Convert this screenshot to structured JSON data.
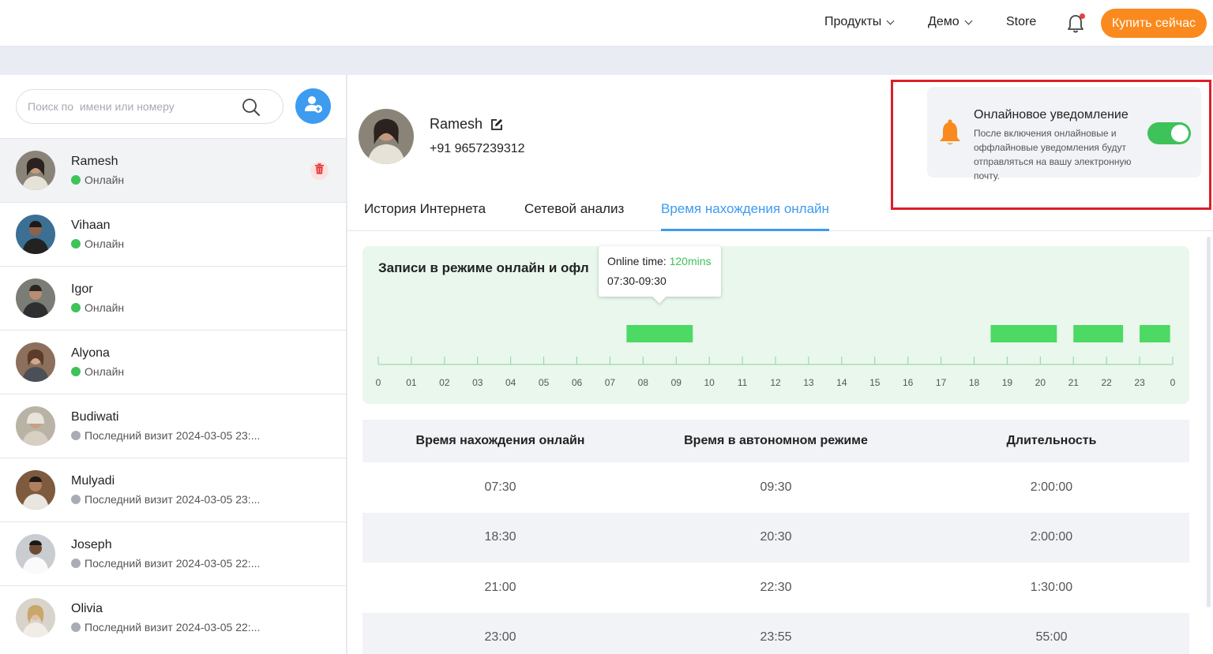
{
  "nav": {
    "products": "Продукты",
    "demo": "Демо",
    "store": "Store",
    "buy_now": "Купить сейчас"
  },
  "sidebar": {
    "search_placeholder": "Поиск по  имени или номеру",
    "contacts": [
      {
        "name": "Ramesh",
        "status": "Онлайн",
        "online": true
      },
      {
        "name": "Vihaan",
        "status": "Онлайн",
        "online": true
      },
      {
        "name": "Igor",
        "status": "Онлайн",
        "online": true
      },
      {
        "name": "Alyona",
        "status": "Онлайн",
        "online": true
      },
      {
        "name": "Budiwati",
        "status": "Последний визит 2024-03-05 23:...",
        "online": false
      },
      {
        "name": "Mulyadi",
        "status": "Последний визит 2024-03-05 23:...",
        "online": false
      },
      {
        "name": "Joseph",
        "status": "Последний визит 2024-03-05 22:...",
        "online": false
      },
      {
        "name": "Olivia",
        "status": "Последний визит 2024-03-05 22:...",
        "online": false
      }
    ]
  },
  "profile": {
    "name": "Ramesh",
    "phone": "+91 9657239312"
  },
  "notification": {
    "title": "Онлайновое уведомление",
    "description": "После включения онлайновые и оффлайновые уведомления будут отправляться на вашу электронную почту.",
    "enabled": true
  },
  "tabs": [
    "История Интернета",
    "Сетевой анализ",
    "Время нахождения онлайн"
  ],
  "active_tab": 2,
  "chart_data": {
    "type": "timeline",
    "title": "Записи в режиме онлайн и офл",
    "tick_labels": [
      "0",
      "01",
      "02",
      "03",
      "04",
      "05",
      "06",
      "07",
      "08",
      "09",
      "10",
      "11",
      "12",
      "13",
      "14",
      "15",
      "16",
      "17",
      "18",
      "19",
      "20",
      "21",
      "22",
      "23",
      "0"
    ],
    "x_range": [
      0,
      24
    ],
    "segments": [
      {
        "start": 7.5,
        "end": 9.5
      },
      {
        "start": 18.5,
        "end": 20.5
      },
      {
        "start": 21.0,
        "end": 22.5
      },
      {
        "start": 23.0,
        "end": 23.92
      }
    ],
    "color": "#4cd964",
    "tooltip": {
      "label": "Online time: ",
      "value": "120mins",
      "range": "07:30-09:30"
    }
  },
  "table": {
    "headers": [
      "Время нахождения онлайн",
      "Время в автономном режиме",
      "Длительность"
    ],
    "rows": [
      [
        "07:30",
        "09:30",
        "2:00:00"
      ],
      [
        "18:30",
        "20:30",
        "2:00:00"
      ],
      [
        "21:00",
        "22:30",
        "1:30:00"
      ],
      [
        "23:00",
        "23:55",
        "55:00"
      ]
    ]
  }
}
